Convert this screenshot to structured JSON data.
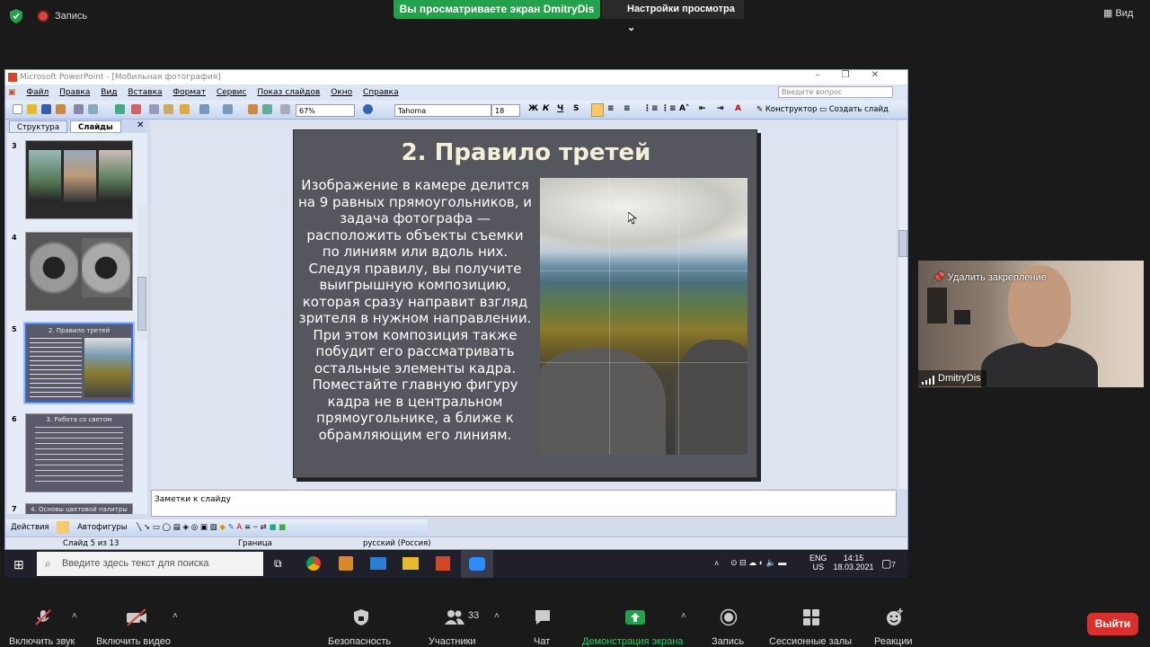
{
  "zoom": {
    "recording_label": "Запись",
    "share_banner": "Вы просматриваете экран DmitryDis",
    "view_options": "Настройки просмотра",
    "view_button": "Вид",
    "pin_label": "Удалить закрепление",
    "participant_name": "DmitryDis",
    "controls": {
      "audio": "Включить звук",
      "video": "Включить видео",
      "security": "Безопасность",
      "participants": "Участники",
      "participants_count": "33",
      "chat": "Чат",
      "share": "Демонстрация экрана",
      "record": "Запись",
      "breakout": "Сессионные залы",
      "reactions": "Реакции",
      "leave": "Выйти"
    }
  },
  "ppt": {
    "title": "Microsoft PowerPoint - [Мобильная фотография]",
    "menu": [
      "Файл",
      "Правка",
      "Вид",
      "Вставка",
      "Формат",
      "Сервис",
      "Показ слайдов",
      "Окно",
      "Справка"
    ],
    "ask_placeholder": "Введите вопрос",
    "zoom": "67%",
    "font": "Tahoma",
    "font_size": "18",
    "designer": "Конструктор",
    "new_slide": "Создать слайд",
    "tab_outline": "Структура",
    "tab_slides": "Слайды",
    "thumbnails": [
      {
        "num": "3"
      },
      {
        "num": "4"
      },
      {
        "num": "5",
        "title": "2. Правило третей"
      },
      {
        "num": "6",
        "title": "3. Работа со светом"
      },
      {
        "num": "7",
        "title": "4. Основы цветовой палитры"
      }
    ],
    "slide": {
      "title": "2. Правило третей",
      "body": "Изображение в камере делится на 9 равных прямоугольников, и задача фотографа — расположить объекты съемки по линиям или вдоль них. Следуя правилу, вы получите выигрышную композицию, которая сразу направит взгляд зрителя в нужном направлении. При этом композиция также побудит его рассматривать остальные элементы кадра. Поместайте главную фигуру кадра не в центральном прямоугольнике, а ближе к обрамляющим его линиям."
    },
    "notes_placeholder": "Заметки к слайду",
    "draw_actions": "Действия",
    "draw_autoshapes": "Автофигуры",
    "status": {
      "slide": "Слайд 5 из 13",
      "design": "Граница",
      "language": "русский (Россия)"
    }
  },
  "taskbar": {
    "search_placeholder": "Введите здесь текст для поиска",
    "lang": "ENG",
    "layout": "US",
    "time": "14:15",
    "date": "18.03.2021",
    "notif_count": "7"
  }
}
